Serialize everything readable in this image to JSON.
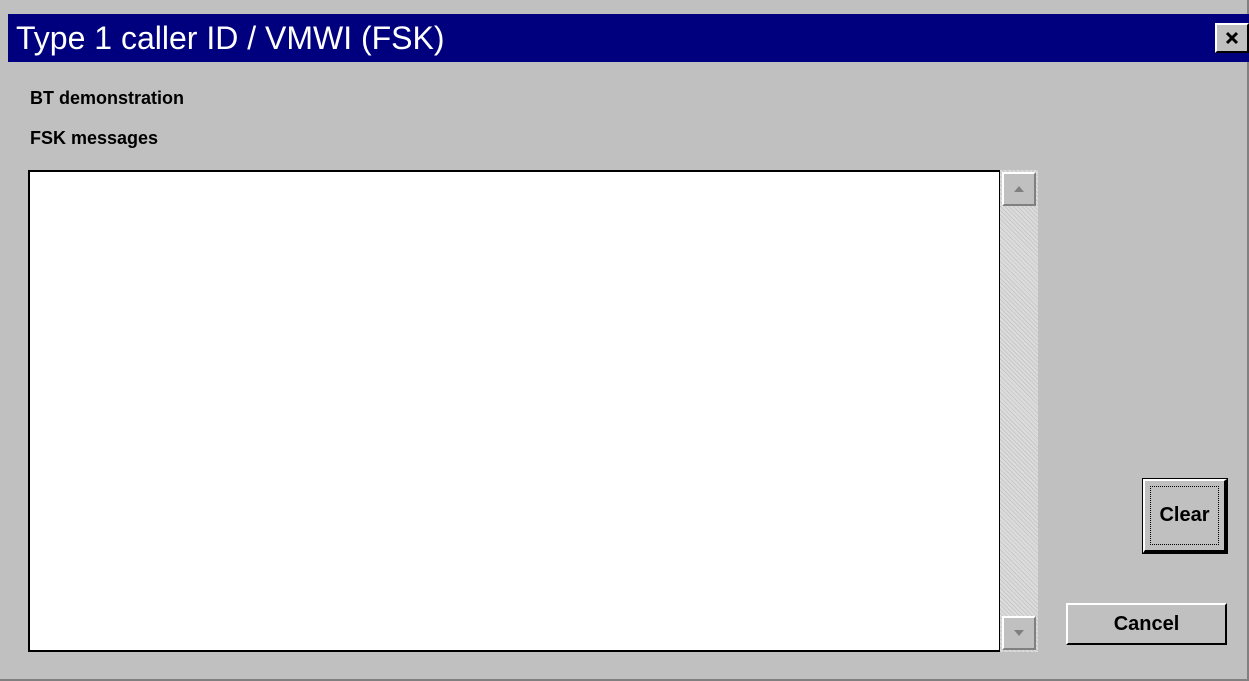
{
  "window": {
    "title": "Type 1 caller ID / VMWI (FSK)",
    "title_bar_color": "#00007f",
    "background_color": "#c0c0c0"
  },
  "title_bar": {
    "close_icon": "close-icon"
  },
  "labels": {
    "demo": "BT demonstration",
    "fsk_messages": "FSK messages"
  },
  "messages": {
    "value": ""
  },
  "scrollbar": {
    "up_icon": "scroll-up-arrow-icon",
    "down_icon": "scroll-down-arrow-icon"
  },
  "buttons": {
    "clear_label": "Clear",
    "cancel_label": "Cancel"
  }
}
